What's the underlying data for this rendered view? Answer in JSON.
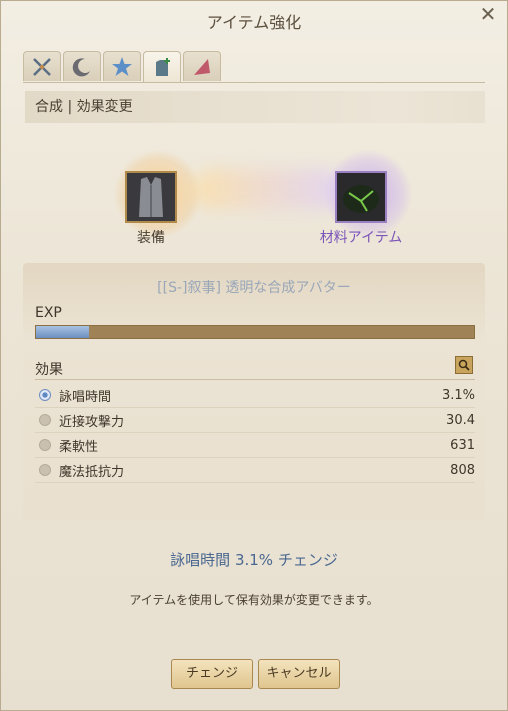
{
  "window": {
    "title": "アイテム強化",
    "close_glyph": "✕"
  },
  "tabs": [
    {
      "icon": "crossed-swords-icon",
      "active": false
    },
    {
      "icon": "moon-icon",
      "active": false
    },
    {
      "icon": "star-icon",
      "active": false
    },
    {
      "icon": "shirt-plus-icon",
      "active": true
    },
    {
      "icon": "arrowhead-icon",
      "active": false
    }
  ],
  "breadcrumb": "合成 | 効果変更",
  "slots": {
    "equip_label": "装備",
    "material_label": "材料アイテム"
  },
  "item": {
    "name": "[[S-]叙事] 透明な合成アバター"
  },
  "exp": {
    "label": "EXP",
    "progress": 0.12
  },
  "effects": {
    "label": "効果",
    "rows": [
      {
        "name": "詠唱時間",
        "value": "3.1%",
        "selected": true
      },
      {
        "name": "近接攻撃力",
        "value": "30.4",
        "selected": false
      },
      {
        "name": "柔軟性",
        "value": "631",
        "selected": false
      },
      {
        "name": "魔法抵抗力",
        "value": "808",
        "selected": false
      }
    ]
  },
  "summary": "詠唱時間 3.1% チェンジ",
  "help_text": "アイテムを使用して保有効果が変更できます。",
  "buttons": {
    "change": "チェンジ",
    "cancel": "キャンセル"
  },
  "colors": {
    "accent_blue": "#4a6890",
    "material_purple": "#7b55b8",
    "gold_border": "#b08a4a"
  }
}
